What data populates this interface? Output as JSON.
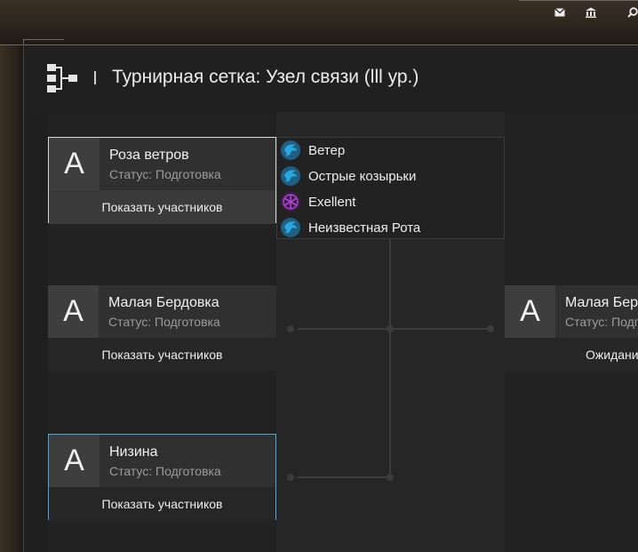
{
  "page": {
    "title": "Турнирная сетка: Узел связи (lll ур.)",
    "header_icon": "bracket-tree-icon"
  },
  "top_bar": {
    "icons": [
      "mail-icon",
      "bank-icon",
      "search-icon"
    ]
  },
  "bracket": {
    "round1": [
      {
        "avatar": "A",
        "name": "Роза ветров",
        "status": "Статус: Подготовка",
        "button": "Показать участников",
        "state": "selected"
      },
      {
        "avatar": "A",
        "name": "Малая Бердовка",
        "status": "Статус: Подготовка",
        "button": "Показать участников",
        "state": "normal"
      },
      {
        "avatar": "A",
        "name": "Низина",
        "status": "Статус: Подготовка",
        "button": "Показать участников",
        "state": "highlighted"
      }
    ],
    "round2": [
      {
        "avatar": "A",
        "name": "Малая Бер",
        "status": "Статус: Подго",
        "button": "Ожидани"
      }
    ]
  },
  "participants": [
    {
      "name": "Ветер",
      "icon": "eagle-emblem-icon",
      "color": "#2aa7e0"
    },
    {
      "name": "Острые козырьки",
      "icon": "eagle-emblem-icon",
      "color": "#2aa7e0"
    },
    {
      "name": "Exellent",
      "icon": "rune-emblem-icon",
      "color": "#b042d6"
    },
    {
      "name": "Неизвестная Рота",
      "icon": "eagle-emblem-icon",
      "color": "#2aa7e0"
    }
  ],
  "colors": {
    "accent_selected_border": "#d9d9d9",
    "accent_highlight_border": "#4aa6d8"
  }
}
